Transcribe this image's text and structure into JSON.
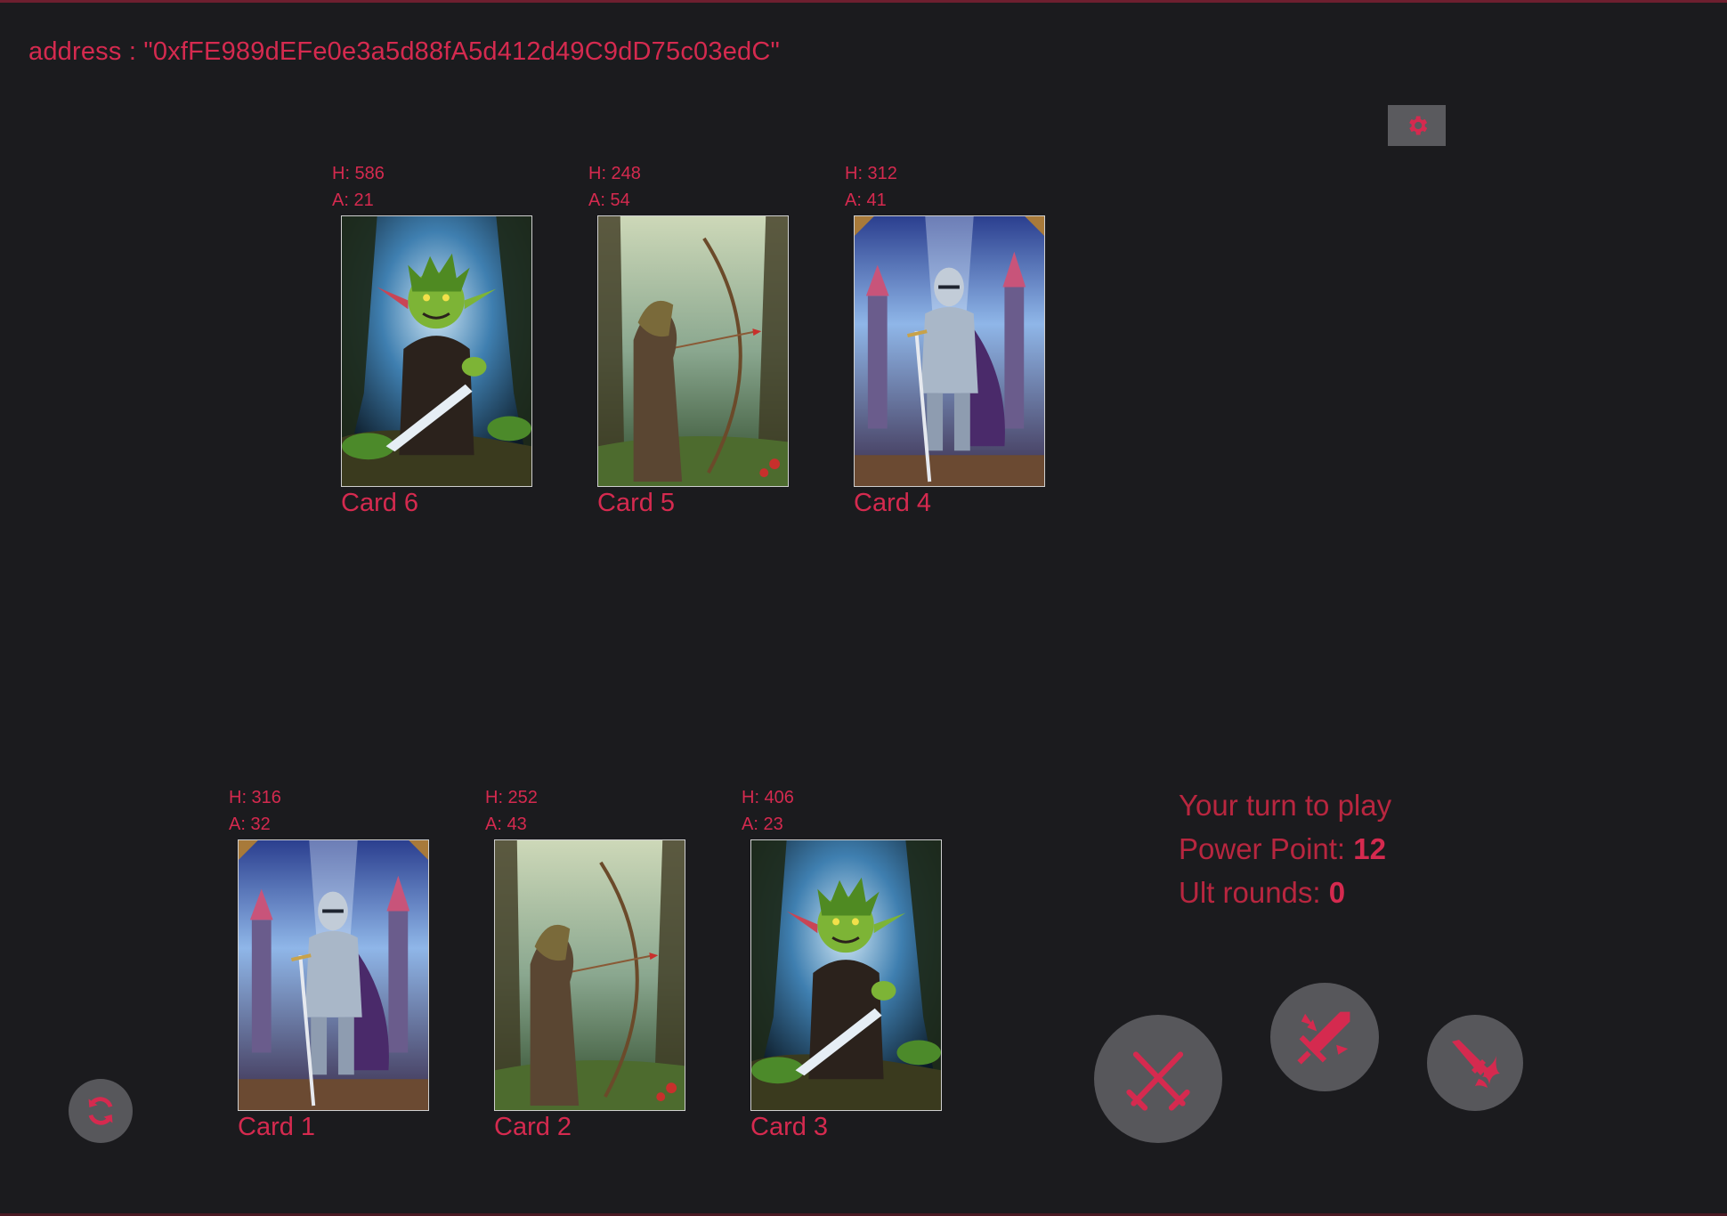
{
  "header": {
    "address_label": "address : \"0xfFE989dEFe0e3a5d88fA5d412d49C9dD75c03edC\""
  },
  "opponent_cards": [
    {
      "name": "Card 6",
      "health": "H: 586",
      "attack": "A: 21",
      "art": "goblin"
    },
    {
      "name": "Card 5",
      "health": "H: 248",
      "attack": "A: 54",
      "art": "archer"
    },
    {
      "name": "Card 4",
      "health": "H: 312",
      "attack": "A: 41",
      "art": "knight"
    }
  ],
  "player_cards": [
    {
      "name": "Card 1",
      "health": "H: 316",
      "attack": "A: 32",
      "art": "knight"
    },
    {
      "name": "Card 2",
      "health": "H: 252",
      "attack": "A: 43",
      "art": "archer"
    },
    {
      "name": "Card 3",
      "health": "H: 406",
      "attack": "A: 23",
      "art": "goblin"
    }
  ],
  "status": {
    "turn_text": "Your turn to play",
    "power_label": "Power Point: ",
    "power_value": "12",
    "ult_label": "Ult rounds: ",
    "ult_value": "0"
  },
  "icons": {
    "settings": "gear-icon",
    "refresh": "refresh-icon",
    "attack": "crossed-swords-icon",
    "special": "sword-burst-icon",
    "ultimate": "flaming-sword-icon"
  },
  "colors": {
    "background": "#1b1b1e",
    "accent": "#d52a4f",
    "button": "#57575b"
  }
}
